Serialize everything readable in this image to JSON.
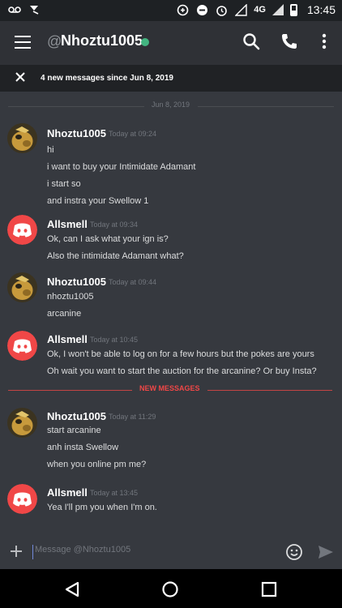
{
  "status_bar": {
    "network": "4G",
    "time": "13:45"
  },
  "header": {
    "at_symbol": "@",
    "channel_name": "Nhoztu1005",
    "status_color": "#43b581"
  },
  "banner": {
    "text": "4 new messages since Jun 8, 2019"
  },
  "dividers": {
    "date": "Jun 8, 2019",
    "new_messages": "NEW MESSAGES"
  },
  "messages": [
    {
      "author": "Nhoztu1005",
      "timestamp": "Today at 09:24",
      "avatar": "nhoztu-avatar",
      "lines": [
        "hi",
        "i want to buy your Intimidate Adamant",
        "i start so",
        "and instra your Swellow 1"
      ]
    },
    {
      "author": "Allsmell",
      "timestamp": "Today at 09:34",
      "avatar": "discord-default-avatar",
      "lines": [
        "Ok, can I ask what your ign is?",
        "Also the intimidate Adamant what?"
      ]
    },
    {
      "author": "Nhoztu1005",
      "timestamp": "Today at 09:44",
      "avatar": "nhoztu-avatar",
      "lines": [
        "nhoztu1005",
        "arcanine"
      ]
    },
    {
      "author": "Allsmell",
      "timestamp": "Today at 10:45",
      "avatar": "discord-default-avatar",
      "lines": [
        "Ok, I won't be able to log on for a few hours but the pokes are yours",
        "Oh wait you want to start the auction for the arcanine? Or buy Insta?"
      ]
    },
    {
      "author": "Nhoztu1005",
      "timestamp": "Today at 11:29",
      "avatar": "nhoztu-avatar",
      "lines": [
        "start arcanine",
        "anh insta Swellow",
        "when you online pm me?"
      ]
    },
    {
      "author": "Allsmell",
      "timestamp": "Today at 13:45",
      "avatar": "discord-default-avatar",
      "lines": [
        "Yea I'll pm you when I'm on."
      ]
    }
  ],
  "composer": {
    "placeholder": "Message @Nhoztu1005"
  },
  "colors": {
    "background": "#36393f",
    "header": "#2f3136",
    "banner": "#202225",
    "discord_red": "#f04747",
    "new_messages_red": "#f04747",
    "online_green": "#43b581"
  },
  "icons": {
    "header": [
      "hamburger-menu-icon",
      "search-icon",
      "phone-call-icon",
      "more-vertical-icon"
    ],
    "banner": "close-icon",
    "composer": [
      "add-icon",
      "emoji-icon",
      "send-icon"
    ],
    "nav": [
      "back-icon",
      "home-icon",
      "recents-icon"
    ]
  }
}
